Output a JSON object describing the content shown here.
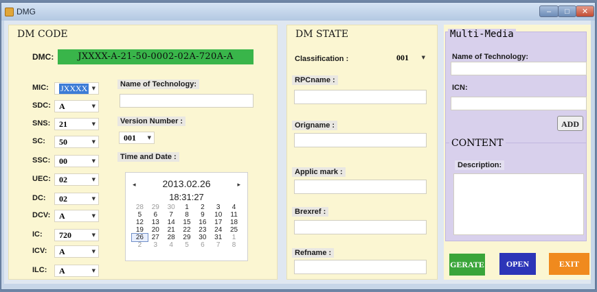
{
  "window": {
    "title": "DMG",
    "min": "–",
    "max": "□",
    "close": "✕"
  },
  "dm_code": {
    "legend": "DM CODE",
    "dmc_label": "DMC:",
    "dmc_value": "JXXXX-A-21-50-0002-02A-720A-A",
    "fields": [
      {
        "label": "MIC:",
        "value": "JXXXX"
      },
      {
        "label": "SDC:",
        "value": "A"
      },
      {
        "label": "SNS:",
        "value": "21"
      },
      {
        "label": "SC:",
        "value": "50"
      },
      {
        "label": "SSC:",
        "value": "00"
      },
      {
        "label": "UEC:",
        "value": "02"
      },
      {
        "label": "DC:",
        "value": "02"
      },
      {
        "label": "DCV:",
        "value": "A"
      },
      {
        "label": "IC:",
        "value": "720"
      },
      {
        "label": "ICV:",
        "value": "A"
      },
      {
        "label": "ILC:",
        "value": "A"
      }
    ],
    "name_of_technology_label": "Name of Technology:",
    "name_of_technology_value": "",
    "version_number_label": "Version Number :",
    "version_number_value": "001",
    "time_and_date_label": "Time and Date :",
    "calendar": {
      "month": "2013.02.26",
      "time": "18:31:27",
      "prev": "◂",
      "next": "▸",
      "days": [
        [
          "28",
          "29",
          "30",
          "1",
          "2",
          "3",
          "4"
        ],
        [
          "5",
          "6",
          "7",
          "8",
          "9",
          "10",
          "11"
        ],
        [
          "12",
          "13",
          "14",
          "15",
          "16",
          "17",
          "18"
        ],
        [
          "19",
          "20",
          "21",
          "22",
          "23",
          "24",
          "25"
        ],
        [
          "26",
          "27",
          "28",
          "29",
          "30",
          "31",
          "1"
        ],
        [
          "2",
          "3",
          "4",
          "5",
          "6",
          "7",
          "8"
        ]
      ],
      "selected": "26"
    }
  },
  "dm_state": {
    "legend": "DM STATE",
    "classification_label": "Classification :",
    "classification_value": "001",
    "rpcname_label": "RPCname :",
    "orignome_label": "Origname :",
    "applic_mark_label": "Applic mark :",
    "brexref_label": "Brexref :",
    "refname_label": "Refname :"
  },
  "multimedia": {
    "legend": "Multi-Media",
    "name_of_technology_label": "Name of Technology:",
    "icn_label": "ICN:",
    "add_label": "ADD"
  },
  "content": {
    "legend": "CONTENT",
    "description_label": "Description:"
  },
  "buttons": {
    "generate": "GERATE",
    "open": "OPEN",
    "exit": "EXIT",
    "generate_color": "#3aa53a",
    "open_color": "#2c35b8",
    "exit_color": "#f08a1e"
  },
  "arrow": "▼"
}
